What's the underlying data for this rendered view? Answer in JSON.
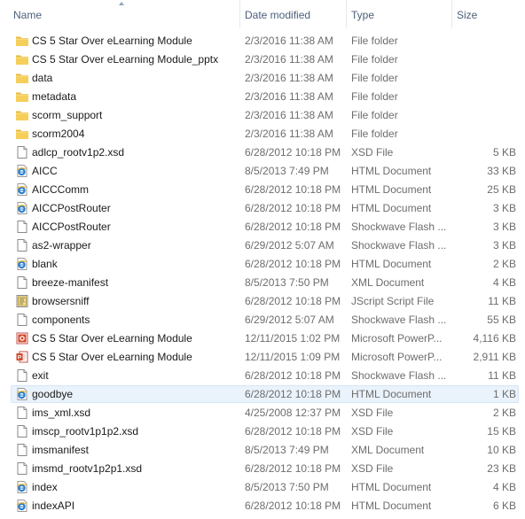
{
  "columns": {
    "name": "Name",
    "date": "Date modified",
    "type": "Type",
    "size": "Size"
  },
  "files": [
    {
      "name": "CS 5 Star Over eLearning Module",
      "date": "2/3/2016 11:38 AM",
      "type": "File folder",
      "size": "",
      "icon": "folder-icon"
    },
    {
      "name": "CS 5 Star Over eLearning Module_pptx",
      "date": "2/3/2016 11:38 AM",
      "type": "File folder",
      "size": "",
      "icon": "folder-icon"
    },
    {
      "name": "data",
      "date": "2/3/2016 11:38 AM",
      "type": "File folder",
      "size": "",
      "icon": "folder-icon"
    },
    {
      "name": "metadata",
      "date": "2/3/2016 11:38 AM",
      "type": "File folder",
      "size": "",
      "icon": "folder-icon"
    },
    {
      "name": "scorm_support",
      "date": "2/3/2016 11:38 AM",
      "type": "File folder",
      "size": "",
      "icon": "folder-icon"
    },
    {
      "name": "scorm2004",
      "date": "2/3/2016 11:38 AM",
      "type": "File folder",
      "size": "",
      "icon": "folder-icon"
    },
    {
      "name": "adlcp_rootv1p2.xsd",
      "date": "6/28/2012 10:18 PM",
      "type": "XSD File",
      "size": "5 KB",
      "icon": "file-icon"
    },
    {
      "name": "AICC",
      "date": "8/5/2013 7:49 PM",
      "type": "HTML Document",
      "size": "33 KB",
      "icon": "ie-html-icon"
    },
    {
      "name": "AICCComm",
      "date": "6/28/2012 10:18 PM",
      "type": "HTML Document",
      "size": "25 KB",
      "icon": "ie-html-icon"
    },
    {
      "name": "AICCPostRouter",
      "date": "6/28/2012 10:18 PM",
      "type": "HTML Document",
      "size": "3 KB",
      "icon": "ie-html-icon"
    },
    {
      "name": "AICCPostRouter",
      "date": "6/28/2012 10:18 PM",
      "type": "Shockwave Flash ...",
      "size": "3 KB",
      "icon": "file-icon"
    },
    {
      "name": "as2-wrapper",
      "date": "6/29/2012 5:07 AM",
      "type": "Shockwave Flash ...",
      "size": "3 KB",
      "icon": "file-icon"
    },
    {
      "name": "blank",
      "date": "6/28/2012 10:18 PM",
      "type": "HTML Document",
      "size": "2 KB",
      "icon": "ie-html-icon"
    },
    {
      "name": "breeze-manifest",
      "date": "8/5/2013 7:50 PM",
      "type": "XML Document",
      "size": "4 KB",
      "icon": "file-icon"
    },
    {
      "name": "browsersniff",
      "date": "6/28/2012 10:18 PM",
      "type": "JScript Script File",
      "size": "11 KB",
      "icon": "script-icon"
    },
    {
      "name": "components",
      "date": "6/29/2012 5:07 AM",
      "type": "Shockwave Flash ...",
      "size": "55 KB",
      "icon": "file-icon"
    },
    {
      "name": "CS 5 Star Over eLearning Module",
      "date": "12/11/2015 1:02 PM",
      "type": "Microsoft PowerP...",
      "size": "4,116 KB",
      "icon": "powerpoint-show-icon"
    },
    {
      "name": "CS 5 Star Over eLearning Module",
      "date": "12/11/2015 1:09 PM",
      "type": "Microsoft PowerP...",
      "size": "2,911 KB",
      "icon": "powerpoint-icon"
    },
    {
      "name": "exit",
      "date": "6/28/2012 10:18 PM",
      "type": "Shockwave Flash ...",
      "size": "11 KB",
      "icon": "file-icon"
    },
    {
      "name": "goodbye",
      "date": "6/28/2012 10:18 PM",
      "type": "HTML Document",
      "size": "1 KB",
      "icon": "ie-html-icon",
      "selected": true
    },
    {
      "name": "ims_xml.xsd",
      "date": "4/25/2008 12:37 PM",
      "type": "XSD File",
      "size": "2 KB",
      "icon": "file-icon"
    },
    {
      "name": "imscp_rootv1p1p2.xsd",
      "date": "6/28/2012 10:18 PM",
      "type": "XSD File",
      "size": "15 KB",
      "icon": "file-icon"
    },
    {
      "name": "imsmanifest",
      "date": "8/5/2013 7:49 PM",
      "type": "XML Document",
      "size": "10 KB",
      "icon": "file-icon"
    },
    {
      "name": "imsmd_rootv1p2p1.xsd",
      "date": "6/28/2012 10:18 PM",
      "type": "XSD File",
      "size": "23 KB",
      "icon": "file-icon"
    },
    {
      "name": "index",
      "date": "8/5/2013 7:50 PM",
      "type": "HTML Document",
      "size": "4 KB",
      "icon": "ie-html-icon"
    },
    {
      "name": "indexAPI",
      "date": "6/28/2012 10:18 PM",
      "type": "HTML Document",
      "size": "6 KB",
      "icon": "ie-html-icon"
    }
  ]
}
